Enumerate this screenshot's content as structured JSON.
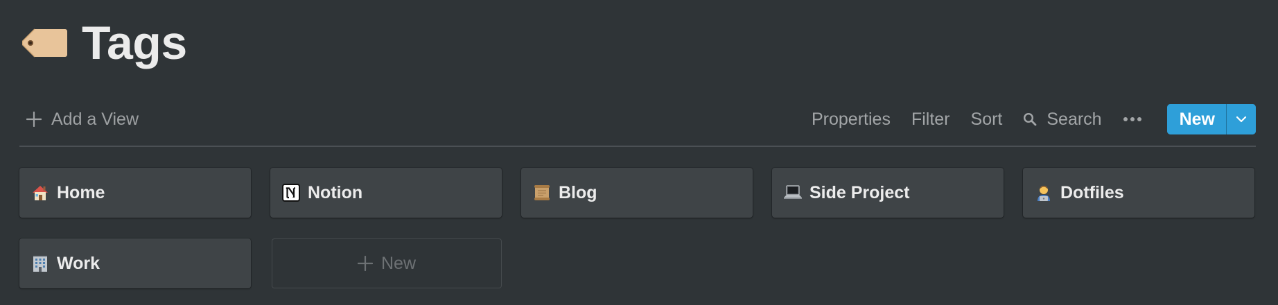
{
  "header": {
    "title": "Tags",
    "icon": "label-tag-icon"
  },
  "toolbar": {
    "add_view_label": "Add a View",
    "properties_label": "Properties",
    "filter_label": "Filter",
    "sort_label": "Sort",
    "search_label": "Search",
    "more_icon": "ellipsis-icon",
    "new_label": "New",
    "new_caret_icon": "chevron-down-icon"
  },
  "cards": [
    {
      "label": "Home",
      "icon": "house-icon"
    },
    {
      "label": "Notion",
      "icon": "notion-logo-icon"
    },
    {
      "label": "Blog",
      "icon": "scroll-icon"
    },
    {
      "label": "Side Project",
      "icon": "laptop-icon"
    },
    {
      "label": "Dotfiles",
      "icon": "technologist-icon"
    },
    {
      "label": "Work",
      "icon": "office-building-icon"
    }
  ],
  "new_card": {
    "label": "New"
  },
  "colors": {
    "background": "#2f3437",
    "card": "#3f4447",
    "accent": "#2e9fd9",
    "muted_text": "#a3a6a8"
  }
}
